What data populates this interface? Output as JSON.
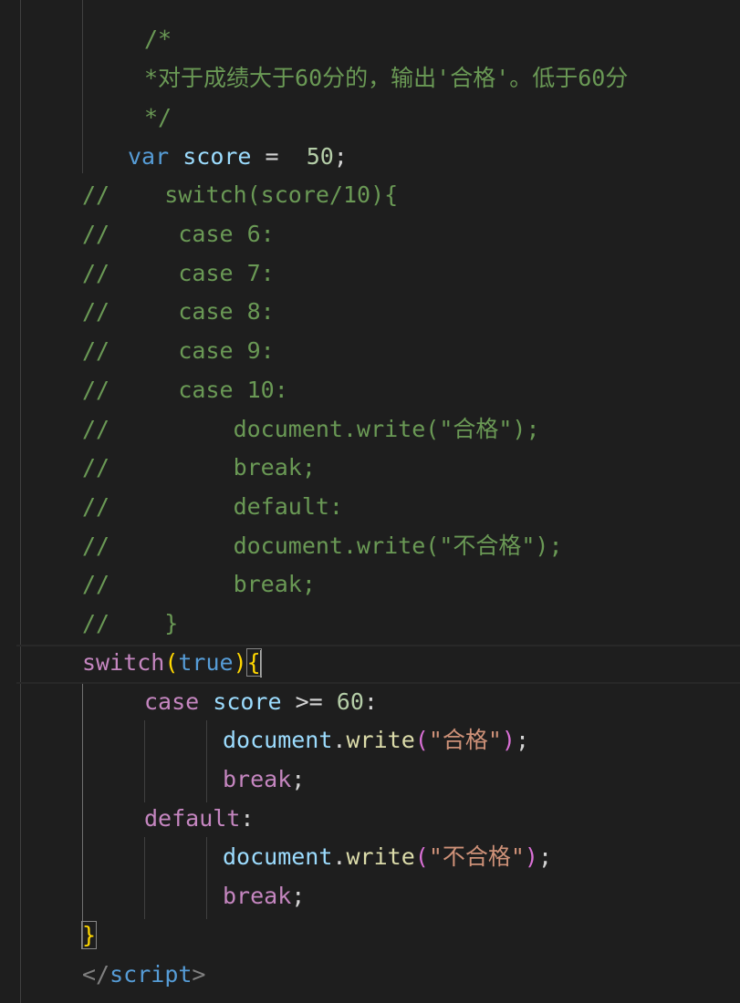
{
  "editor": {
    "lines": [
      [
        {
          "t": "/*",
          "c": "cmt"
        }
      ],
      [
        {
          "t": "*对于成绩大于60分的，输出'合格'。低于60分",
          "c": "cmt"
        }
      ],
      [
        {
          "t": "*/",
          "c": "cmt"
        }
      ],
      [
        {
          "t": "var",
          "c": "kw"
        },
        {
          "t": " ",
          "c": "punc"
        },
        {
          "t": "score",
          "c": "var"
        },
        {
          "t": " = ",
          "c": "punc"
        },
        {
          "t": " 50",
          "c": "num"
        },
        {
          "t": ";",
          "c": "punc"
        }
      ],
      [
        {
          "t": "//    switch(score/10){",
          "c": "cmt"
        }
      ],
      [
        {
          "t": "//     case 6:",
          "c": "cmt"
        }
      ],
      [
        {
          "t": "//     case 7:",
          "c": "cmt"
        }
      ],
      [
        {
          "t": "//     case 8:",
          "c": "cmt"
        }
      ],
      [
        {
          "t": "//     case 9:",
          "c": "cmt"
        }
      ],
      [
        {
          "t": "//     case 10:",
          "c": "cmt"
        }
      ],
      [
        {
          "t": "//         document.write(\"合格\");",
          "c": "cmt"
        }
      ],
      [
        {
          "t": "//         break;",
          "c": "cmt"
        }
      ],
      [
        {
          "t": "//         default:",
          "c": "cmt"
        }
      ],
      [
        {
          "t": "//         document.write(\"不合格\");",
          "c": "cmt"
        }
      ],
      [
        {
          "t": "//         break;",
          "c": "cmt"
        }
      ],
      [
        {
          "t": "//    }",
          "c": "cmt"
        }
      ],
      [
        {
          "t": "switch",
          "c": "ctl"
        },
        {
          "t": "(",
          "c": "b1"
        },
        {
          "t": "true",
          "c": "kw"
        },
        {
          "t": ")",
          "c": "b1"
        },
        {
          "t": "{",
          "c": "b1 bmatch"
        }
      ],
      [
        {
          "t": "case",
          "c": "ctl"
        },
        {
          "t": " ",
          "c": "punc"
        },
        {
          "t": "score",
          "c": "var"
        },
        {
          "t": " >= ",
          "c": "punc"
        },
        {
          "t": "60",
          "c": "num"
        },
        {
          "t": ":",
          "c": "punc"
        }
      ],
      [
        {
          "t": "document",
          "c": "var"
        },
        {
          "t": ".",
          "c": "punc"
        },
        {
          "t": "write",
          "c": "fn"
        },
        {
          "t": "(",
          "c": "b2"
        },
        {
          "t": "\"合格\"",
          "c": "str"
        },
        {
          "t": ")",
          "c": "b2"
        },
        {
          "t": ";",
          "c": "punc"
        }
      ],
      [
        {
          "t": "break",
          "c": "ctl"
        },
        {
          "t": ";",
          "c": "punc"
        }
      ],
      [
        {
          "t": "default",
          "c": "ctl"
        },
        {
          "t": ":",
          "c": "punc"
        }
      ],
      [
        {
          "t": "document",
          "c": "var"
        },
        {
          "t": ".",
          "c": "punc"
        },
        {
          "t": "write",
          "c": "fn"
        },
        {
          "t": "(",
          "c": "b2"
        },
        {
          "t": "\"不合格\"",
          "c": "str"
        },
        {
          "t": ")",
          "c": "b2"
        },
        {
          "t": ";",
          "c": "punc"
        }
      ],
      [
        {
          "t": "break",
          "c": "ctl"
        },
        {
          "t": ";",
          "c": "punc"
        }
      ],
      [
        {
          "t": "}",
          "c": "b1 bmatch"
        }
      ],
      [
        {
          "t": "</",
          "c": "tag"
        },
        {
          "t": "script",
          "c": "tagname"
        },
        {
          "t": ">",
          "c": "tag"
        }
      ]
    ]
  }
}
